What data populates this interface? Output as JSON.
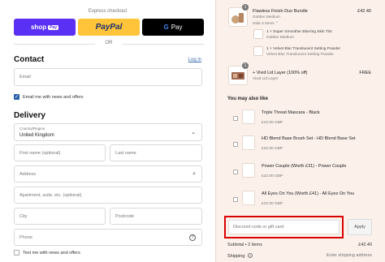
{
  "express": {
    "title": "Express checkout",
    "shop_pay": "shop",
    "shop_pay_chip": "Pay",
    "paypal": "PayPal",
    "gpay": "Pay",
    "or": "OR"
  },
  "contact": {
    "title": "Contact",
    "login": "Log in",
    "email_placeholder": "Email",
    "newsletter_label": "Email me with news and offers",
    "newsletter_checked": true
  },
  "delivery": {
    "title": "Delivery",
    "country_label": "Country/Region",
    "country_value": "United Kingdom",
    "first_name": "First name (optional)",
    "last_name": "Last name",
    "address": "Address",
    "apartment": "Apartment, suite, etc. (optional)",
    "city": "City",
    "postcode": "Postcode",
    "phone": "Phone",
    "text_offers": "Text me with news and offers"
  },
  "cart": {
    "bundle": {
      "name": "Flawless Finish Duo Bundle",
      "variant": "Golden Medium",
      "price": "£42.40",
      "qty": "1",
      "hide_label": "Hide 2 items",
      "items": [
        {
          "name": "1 × Super Smoother Blurring Skin Tint",
          "variant": "Golden Medium"
        },
        {
          "name": "1 × Velvet Blur Translucent Setting Powder",
          "variant": "Velvet Blur Translucent Setting Powder"
        }
      ]
    },
    "gift": {
      "name": "+ Vivid Lid Layer (100% off)",
      "variant": "Vivid Lid Layer",
      "price": "FREE",
      "qty": "1"
    }
  },
  "recommendations": {
    "title": "You may also like",
    "items": [
      {
        "name": "Triple Threat Mascara - Black",
        "price": "£10.00 GBP"
      },
      {
        "name": "HD Blend Base Brush Set - HD Blend Base Set",
        "price": "£22.00 GBP"
      },
      {
        "name": "Power Couple (Worth £31) - Power Couple",
        "price": "£22.00 GBP"
      },
      {
        "name": "All Eyes On You (Worth £41) - All Eyes On You",
        "price": "£22.00 GBP"
      }
    ]
  },
  "discount": {
    "placeholder": "Discount code or gift card",
    "apply": "Apply"
  },
  "summary": {
    "subtotal_label": "Subtotal • 2 items",
    "subtotal_value": "£42.40",
    "shipping_label": "Shipping",
    "shipping_value": "Enter shipping address"
  },
  "colors": {
    "shop_pay": "#5a31f4",
    "paypal": "#ffc439",
    "accent": "#2b5fa8",
    "panel_bg": "#fbf0ea",
    "highlight": "#d90000"
  }
}
